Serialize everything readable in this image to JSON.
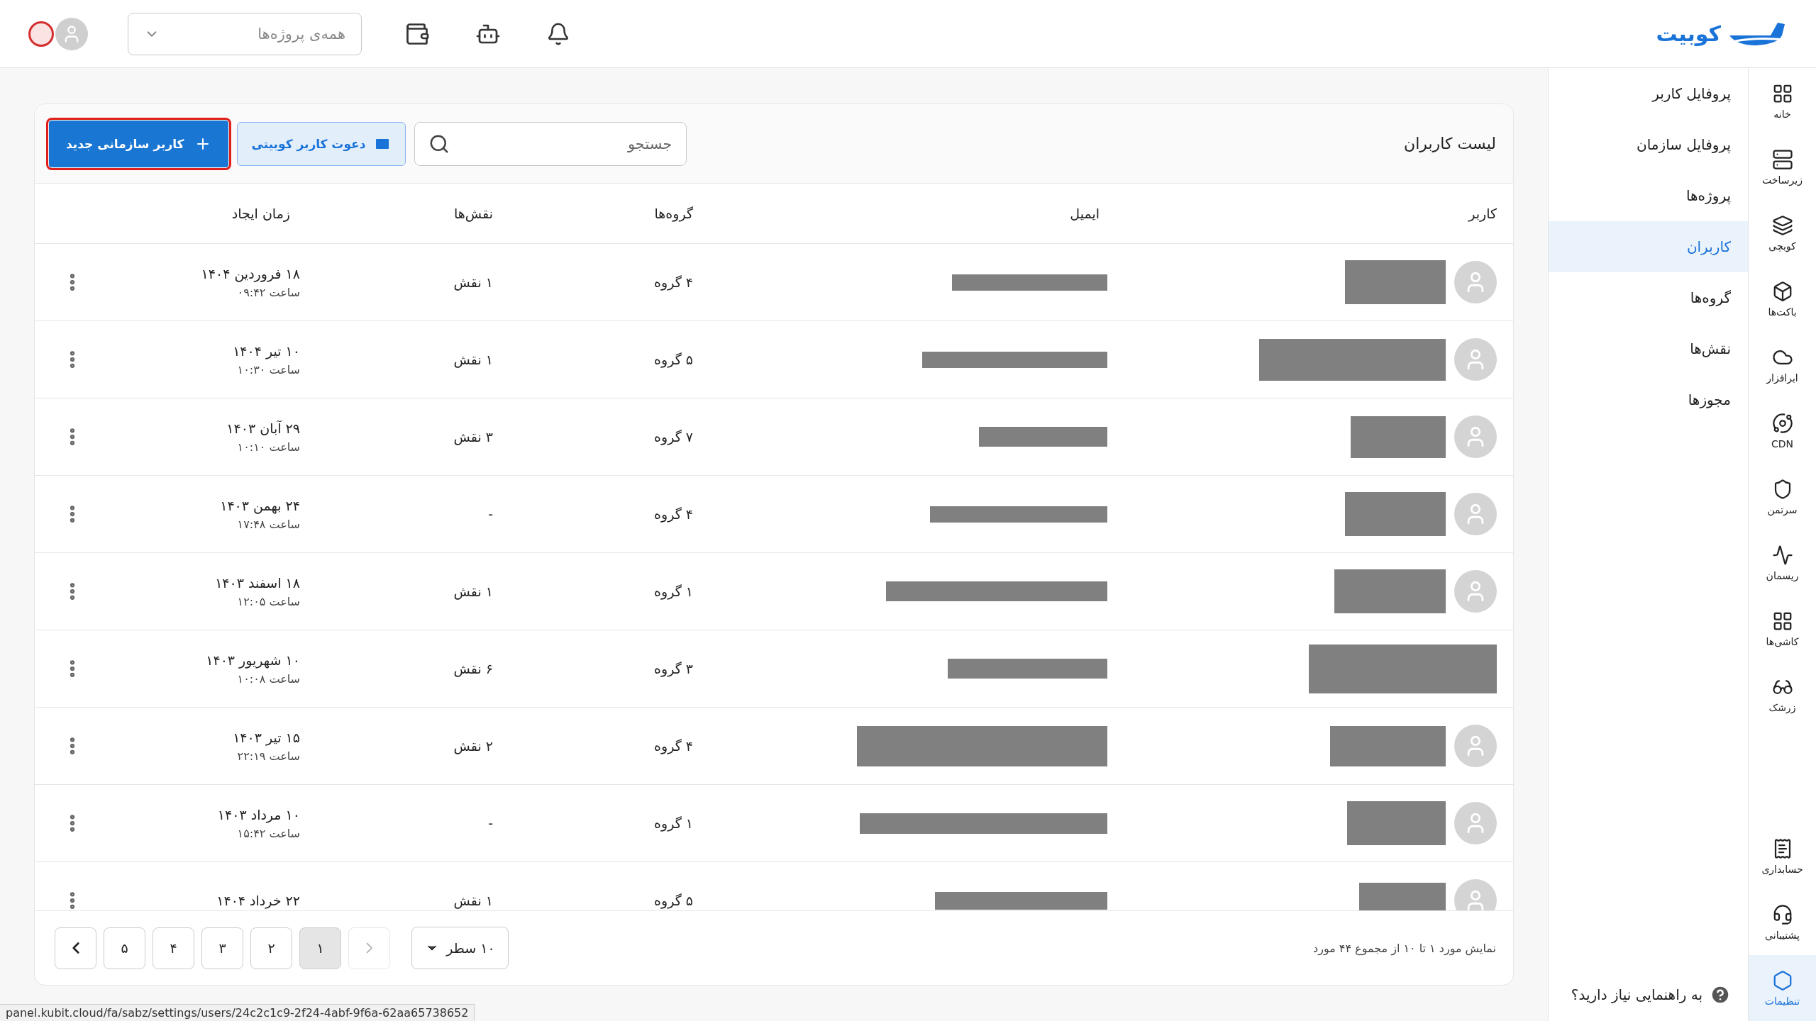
{
  "header": {
    "logo_text": "کوبیت",
    "project_select": {
      "placeholder": "همه‌ی پروژه‌ها"
    }
  },
  "rail": {
    "top": [
      {
        "label": "خانه",
        "selected": false
      },
      {
        "label": "زیرساخت",
        "selected": false
      },
      {
        "label": "کوبچی",
        "selected": false
      },
      {
        "label": "باکت‌ها",
        "selected": false
      },
      {
        "label": "ابرافزار",
        "selected": false
      },
      {
        "label": "CDN",
        "selected": false
      },
      {
        "label": "سرتمن",
        "selected": false
      },
      {
        "label": "ریسمان",
        "selected": false
      },
      {
        "label": "کاشی‌ها",
        "selected": false
      },
      {
        "label": "زرشک",
        "selected": false
      }
    ],
    "bottom": [
      {
        "label": "حسابداری",
        "selected": false
      },
      {
        "label": "پشتیبانی",
        "selected": false
      },
      {
        "label": "تنظیمات",
        "selected": true
      }
    ]
  },
  "settings_menu": {
    "items": [
      {
        "label": "پروفایل کاربر",
        "selected": false
      },
      {
        "label": "پروفایل سازمان",
        "selected": false
      },
      {
        "label": "پروژه‌ها",
        "selected": false
      },
      {
        "label": "کاربران",
        "selected": true
      },
      {
        "label": "گروه‌ها",
        "selected": false
      },
      {
        "label": "نقش‌ها",
        "selected": false
      },
      {
        "label": "مجوزها",
        "selected": false
      }
    ],
    "help": "به راهنمایی نیاز دارید؟"
  },
  "users_card": {
    "title": "لیست کاربران",
    "search": {
      "placeholder": "جستجو"
    },
    "invite_button": "دعوت کاربر کوبیتی",
    "new_button": {
      "label": "کاربر سازمانی جدید",
      "highlighted": true
    },
    "table": {
      "columns": [
        "کاربر",
        "ایمیل",
        "گروه‌ها",
        "نقش‌ها",
        "زمان ایجاد"
      ],
      "rows": [
        {
          "avatar": true,
          "groups": "۴ گروه",
          "roles": "۱ نقش",
          "date": "۱۸ فروردین ۱۴۰۴",
          "time": "ساعت ۰۹:۴۲"
        },
        {
          "avatar": true,
          "groups": "۵ گروه",
          "roles": "۱ نقش",
          "date": "۱۰ تیر ۱۴۰۴",
          "time": "ساعت ۱۰:۳۰"
        },
        {
          "avatar": true,
          "groups": "۷ گروه",
          "roles": "۳ نقش",
          "date": "۲۹ آبان ۱۴۰۳",
          "time": "ساعت ۱۰:۱۰"
        },
        {
          "avatar": true,
          "groups": "۴ گروه",
          "roles": "-",
          "date": "۲۴ بهمن ۱۴۰۳",
          "time": "ساعت ۱۷:۴۸"
        },
        {
          "avatar": true,
          "groups": "۱ گروه",
          "roles": "۱ نقش",
          "date": "۱۸ اسفند ۱۴۰۳",
          "time": "ساعت ۱۲:۰۵"
        },
        {
          "avatar": false,
          "groups": "۳ گروه",
          "roles": "۶ نقش",
          "date": "۱۰ شهریور ۱۴۰۳",
          "time": "ساعت ۱۰:۰۸"
        },
        {
          "avatar": true,
          "groups": "۴ گروه",
          "roles": "۲ نقش",
          "date": "۱۵ تیر ۱۴۰۳",
          "time": "ساعت ۲۲:۱۹"
        },
        {
          "avatar": true,
          "groups": "۱ گروه",
          "roles": "-",
          "date": "۱۰ مرداد ۱۴۰۳",
          "time": "ساعت ۱۵:۴۲"
        },
        {
          "avatar": true,
          "groups": "۵ گروه",
          "roles": "۱ نقش",
          "date": "۲۲ خرداد ۱۴۰۴"
        }
      ]
    },
    "pagination": {
      "summary": "نمایش مورد ۱ تا ۱۰ از مجموع ۴۴ مورد",
      "page_size": "۱۰ سطر",
      "previous_disabled": true,
      "pages": [
        {
          "label": "۱",
          "selected": true
        },
        {
          "label": "۲",
          "selected": false
        },
        {
          "label": "۳",
          "selected": false
        },
        {
          "label": "۴",
          "selected": false
        },
        {
          "label": "۵",
          "selected": false
        }
      ]
    }
  },
  "status_url": "panel.kubit.cloud/fa/sabz/settings/users/24c2c1c9-2f24-4abf-9f6a-62aa65738652"
}
